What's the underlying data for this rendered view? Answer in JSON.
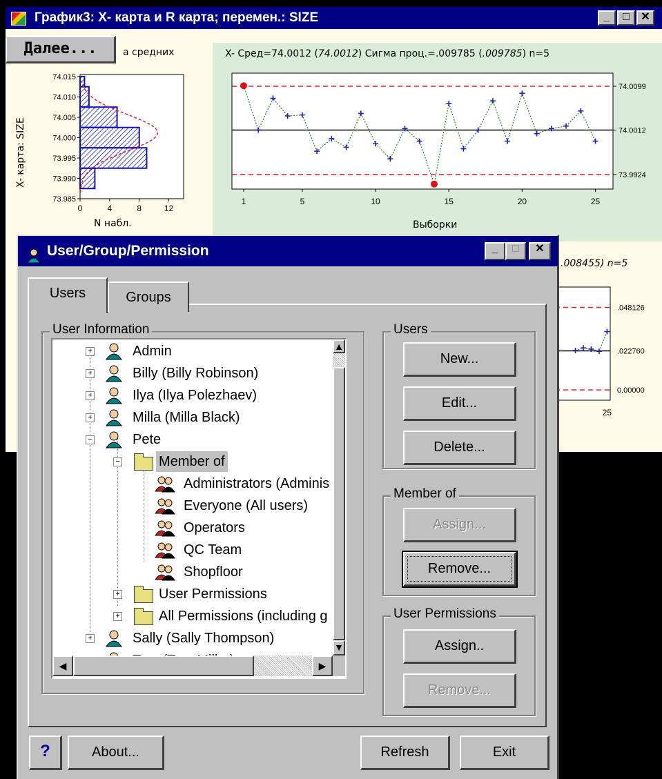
{
  "chart_window": {
    "title": "График3: X- карта и R карта; перемен.: SIZE",
    "next_button": "Далее...",
    "hist_title_partial": "а средних",
    "xbar_header": {
      "prefix": "X-  Сред=74.0012 (",
      "mean_italic": "74.0012",
      "mid": ") Сигма проц.=.009785 (",
      "sigma_italic": ".009785",
      "suffix": ") n=5"
    },
    "r_header_partial": ".008455) n=5",
    "hist_ylabel": "X- карта:  SIZE",
    "hist_xlabel": "N набл.",
    "xbar_xlabel": "Выборки",
    "colors": {
      "panel_green": "#d9ecd9",
      "background": "#fffbe8",
      "limit_red": "#e0202a",
      "points_blue": "#2020c0"
    }
  },
  "chart_data": [
    {
      "type": "bar",
      "orientation": "horizontal",
      "yticks": [
        "74.015",
        "74.010",
        "74.005",
        "74.000",
        "73.995",
        "73.990",
        "73.985"
      ],
      "xticks": [
        "0",
        "4",
        "8",
        "12"
      ],
      "xlabel": "N набл.",
      "ylabel": "X- карта:  SIZE",
      "bins": [
        {
          "from": 74.0125,
          "to": 74.015,
          "count": 0.6
        },
        {
          "from": 74.0075,
          "to": 74.0125,
          "count": 1.2
        },
        {
          "from": 74.0025,
          "to": 74.0075,
          "count": 5
        },
        {
          "from": 73.9975,
          "to": 74.0025,
          "count": 8
        },
        {
          "from": 73.9925,
          "to": 73.9975,
          "count": 9
        },
        {
          "from": 73.9875,
          "to": 73.9925,
          "count": 2
        }
      ],
      "xlim": [
        0,
        14
      ],
      "ylim": [
        73.985,
        74.0155
      ]
    },
    {
      "type": "line",
      "xlabel": "Выборки",
      "xticks": [
        "1",
        "5",
        "10",
        "15",
        "20",
        "25"
      ],
      "right_labels": [
        "74.0099",
        "74.0012",
        "73.9924"
      ],
      "lines": {
        "ucl": 74.0099,
        "center": 74.0012,
        "lcl": 73.9924
      },
      "ylim": [
        73.9895,
        74.0125
      ],
      "xlim": [
        0.2,
        26.2
      ],
      "x": [
        1,
        2,
        3,
        4,
        5,
        6,
        7,
        8,
        9,
        10,
        11,
        12,
        13,
        14,
        15,
        16,
        17,
        18,
        19,
        20,
        21,
        22,
        23,
        24,
        25
      ],
      "values": [
        74.01,
        74.0012,
        74.0075,
        74.004,
        74.0042,
        73.997,
        73.9995,
        73.9978,
        74.0045,
        73.9985,
        73.9955,
        74.0015,
        73.999,
        73.9905,
        74.0065,
        73.9975,
        74.0012,
        74.007,
        73.999,
        74.0085,
        74.0005,
        74.0015,
        74.002,
        74.005,
        73.999
      ],
      "out_of_control": [
        1,
        14
      ]
    },
    {
      "type": "line",
      "right_labels": [
        ".048126",
        ".022760",
        "0.00000"
      ],
      "xticks": [
        "25"
      ],
      "lines": {
        "ucl": 0.048126,
        "center": 0.02276,
        "lcl": 0.0
      },
      "ylim": [
        -0.006,
        0.06
      ],
      "x": [
        21,
        22,
        23,
        24,
        25
      ],
      "values": [
        0.023,
        0.0245,
        0.0238,
        0.0225,
        0.034
      ]
    }
  ],
  "dialog": {
    "title": "User/Group/Permission",
    "tabs": [
      "Users",
      "Groups"
    ],
    "user_info_label": "User Information",
    "tree": {
      "users": [
        "Admin",
        "Billy (Billy Robinson)",
        "Ilya (Ilya Polezhaev)",
        "Milla (Milla Black)",
        "Pete"
      ],
      "member_of": "Member of",
      "groups": [
        "Administrators (Adminis",
        "Everyone (All users)",
        "Operators",
        "QC Team",
        "Shopfloor"
      ],
      "user_permissions": "User Permissions",
      "all_permissions": "All Permissions (including g",
      "users_after": [
        "Sally (Sally Thompson)",
        "Tom (Tom Miller)"
      ]
    },
    "users_group_label": "Users",
    "new_button": "New...",
    "edit_button": "Edit...",
    "delete_button": "Delete...",
    "member_of_group_label": "Member of",
    "assign_button": "Assign...",
    "remove_button": "Remove...",
    "user_permissions_group_label": "User Permissions",
    "perm_assign_button": "Assign..",
    "perm_remove_button": "Remove...",
    "help_button": "?",
    "about_button": "About...",
    "refresh_button": "Refresh",
    "exit_button": "Exit"
  }
}
